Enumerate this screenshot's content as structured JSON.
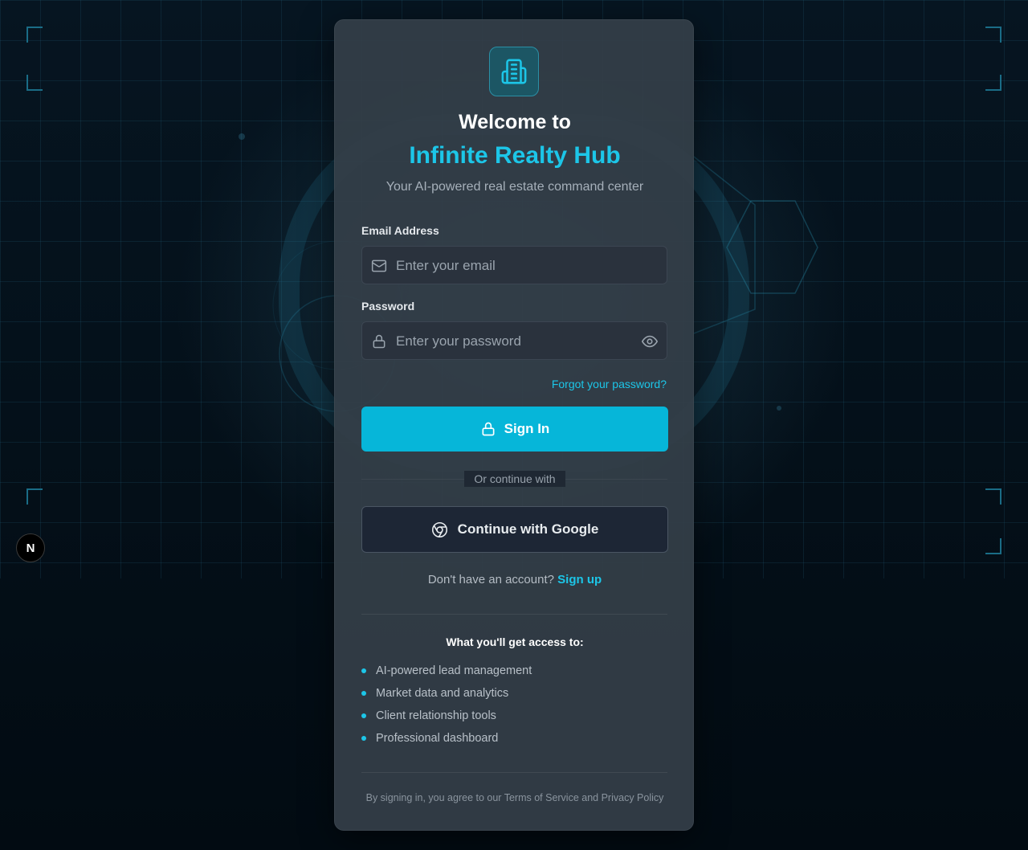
{
  "app": {
    "welcome_text": "Welcome to",
    "brand_name": "Infinite Realty Hub",
    "subtitle": "Your AI-powered real estate command center"
  },
  "form": {
    "email_label": "Email Address",
    "email_placeholder": "Enter your email",
    "email_value": "",
    "password_label": "Password",
    "password_placeholder": "Enter your password",
    "password_value": "",
    "forgot_password": "Forgot your password?",
    "signin_label": "Sign In",
    "divider_text": "Or continue with",
    "google_label": "Continue with Google",
    "no_account_text": "Don't have an account?",
    "signup_link": "Sign up"
  },
  "access": {
    "title": "What you'll get access to:",
    "features": [
      "AI-powered lead management",
      "Market data and analytics",
      "Client relationship tools",
      "Professional dashboard"
    ]
  },
  "footer": {
    "terms_text": "By signing in, you agree to our Terms of Service and Privacy Policy"
  },
  "dev_badge": {
    "letter": "N"
  },
  "icons": {
    "logo": "building-icon",
    "email": "mail-icon",
    "password": "lock-icon",
    "toggle": "eye-icon",
    "signin": "lock-icon",
    "google": "chrome-icon"
  },
  "colors": {
    "accent": "#1cc6e8",
    "button": "#06b6d9",
    "card": "#343e48",
    "background": "#02101a"
  }
}
